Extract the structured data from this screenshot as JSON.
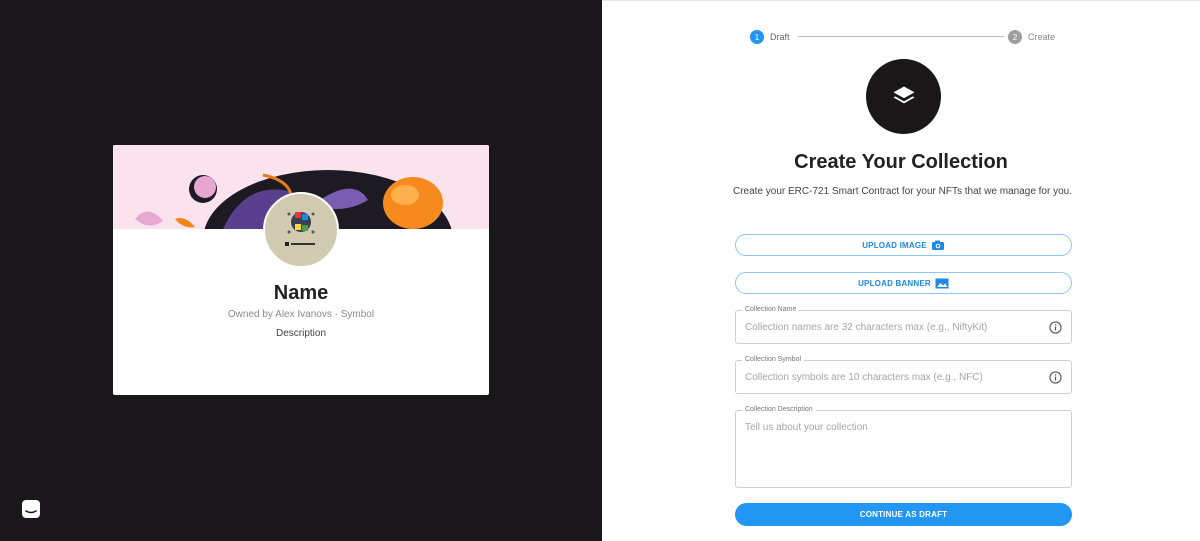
{
  "preview": {
    "name": "Name",
    "owner_line": "Owned by Alex Ivanovs · Symbol",
    "description": "Description"
  },
  "stepper": {
    "steps": [
      {
        "number": "1",
        "label": "Draft",
        "active": true
      },
      {
        "number": "2",
        "label": "Create",
        "active": false
      }
    ]
  },
  "form": {
    "title": "Create Your Collection",
    "subtitle": "Create your ERC-721 Smart Contract for your NFTs that we manage for you.",
    "upload_image_label": "UPLOAD IMAGE",
    "upload_banner_label": "UPLOAD BANNER",
    "fields": {
      "name": {
        "label": "Collection Name",
        "placeholder": "Collection names are 32 characters max (e.g., NiftyKit)"
      },
      "symbol": {
        "label": "Collection Symbol",
        "placeholder": "Collection symbols are 10 characters max (e.g., NFC)"
      },
      "description": {
        "label": "Collection Description",
        "placeholder": "Tell us about your collection"
      }
    },
    "continue_label": "CONTINUE AS DRAFT"
  },
  "colors": {
    "left_bg": "#1a171b",
    "accent": "#2196f3",
    "step_inactive": "#9e9e9e"
  },
  "icons": [
    "layers-icon",
    "camera-icon",
    "image-icon",
    "info-icon",
    "chat-icon"
  ]
}
